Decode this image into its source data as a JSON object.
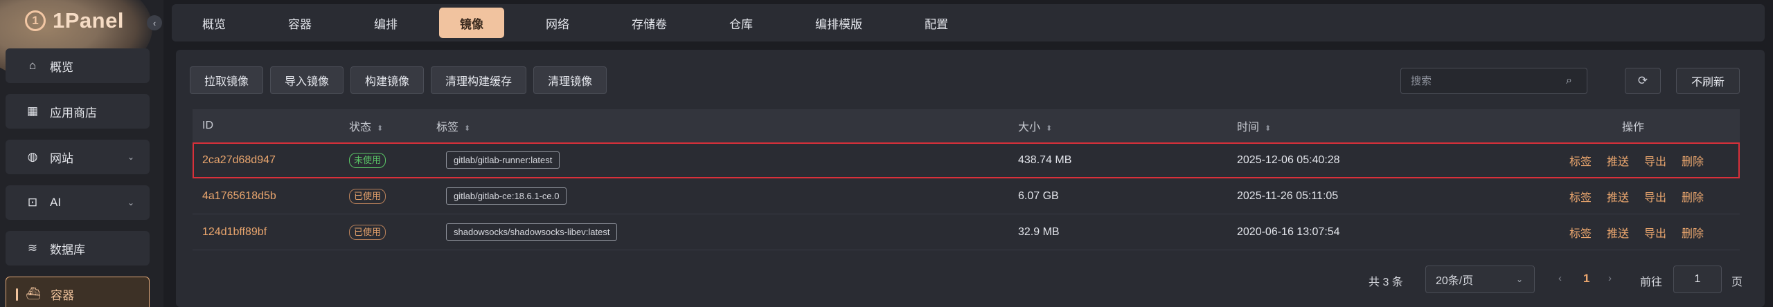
{
  "app": {
    "name": "1Panel"
  },
  "sidebar": {
    "items": [
      {
        "label": "概览",
        "icon": "home-icon",
        "glyph": "⌂"
      },
      {
        "label": "应用商店",
        "icon": "apps-icon",
        "glyph": "▦"
      },
      {
        "label": "网站",
        "icon": "globe-icon",
        "glyph": "◍",
        "expandable": true
      },
      {
        "label": "AI",
        "icon": "robot-icon",
        "glyph": "⊡",
        "expandable": true
      },
      {
        "label": "数据库",
        "icon": "database-icon",
        "glyph": "≋"
      },
      {
        "label": "容器",
        "icon": "docker-icon",
        "glyph": "⛴",
        "active": true
      }
    ]
  },
  "tabs": [
    "概览",
    "容器",
    "编排",
    "镜像",
    "网络",
    "存储卷",
    "仓库",
    "编排模版",
    "配置"
  ],
  "active_tab": "镜像",
  "toolbar": {
    "buttons": [
      "拉取镜像",
      "导入镜像",
      "构建镜像",
      "清理构建缓存",
      "清理镜像"
    ],
    "search_placeholder": "搜索",
    "no_refresh_label": "不刷新"
  },
  "table": {
    "headers": {
      "id": "ID",
      "status": "状态",
      "tag": "标签",
      "size": "大小",
      "time": "时间",
      "ops": "操作"
    },
    "rows": [
      {
        "id": "2ca27d68d947",
        "status": "未使用",
        "status_kind": "unused",
        "tag": "gitlab/gitlab-runner:latest",
        "size": "438.74 MB",
        "time": "2025-12-06 05:40:28",
        "selected": true
      },
      {
        "id": "4a1765618d5b",
        "status": "已使用",
        "status_kind": "used",
        "tag": "gitlab/gitlab-ce:18.6.1-ce.0",
        "size": "6.07 GB",
        "time": "2025-11-26 05:11:05"
      },
      {
        "id": "124d1bff89bf",
        "status": "已使用",
        "status_kind": "used",
        "tag": "shadowsocks/shadowsocks-libev:latest",
        "size": "32.9 MB",
        "time": "2020-06-16 13:07:54"
      }
    ],
    "row_actions": [
      "标签",
      "推送",
      "导出",
      "删除"
    ]
  },
  "pagination": {
    "total_text": "共 3 条",
    "page_size": "20条/页",
    "current_page": "1",
    "goto_label": "前往",
    "goto_value": "1",
    "page_unit": "页"
  },
  "colors": {
    "accent": "#eaa66e",
    "active_tab_bg": "#f1c39f",
    "selected_row_border": "#d9303a",
    "unused_badge": "#5ac466"
  }
}
